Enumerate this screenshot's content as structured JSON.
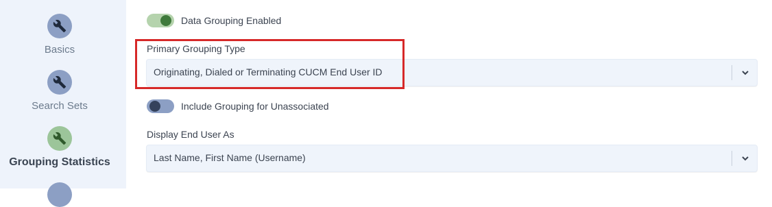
{
  "sidebar": {
    "steps": [
      {
        "label": "Basics",
        "icon": "wrench-icon",
        "active": false
      },
      {
        "label": "Search Sets",
        "icon": "wrench-icon",
        "active": false
      },
      {
        "label": "Grouping Statistics",
        "icon": "wrench-icon",
        "active": true
      },
      {
        "label": "",
        "icon": "wrench-icon",
        "active": false
      }
    ]
  },
  "form": {
    "data_grouping_toggle": {
      "label": "Data Grouping Enabled",
      "on": true
    },
    "primary_grouping": {
      "label": "Primary Grouping Type",
      "value": "Originating, Dialed or Terminating CUCM End User ID"
    },
    "include_unassociated_toggle": {
      "label": "Include Grouping for Unassociated",
      "on": false
    },
    "display_end_user": {
      "label": "Display End User As",
      "value": "Last Name, First Name (Username)"
    }
  },
  "colors": {
    "sidebar_bg": "#eef3fb",
    "inactive_step": "#8c9fc4",
    "active_step": "#9cc59a",
    "highlight": "#d62828"
  }
}
